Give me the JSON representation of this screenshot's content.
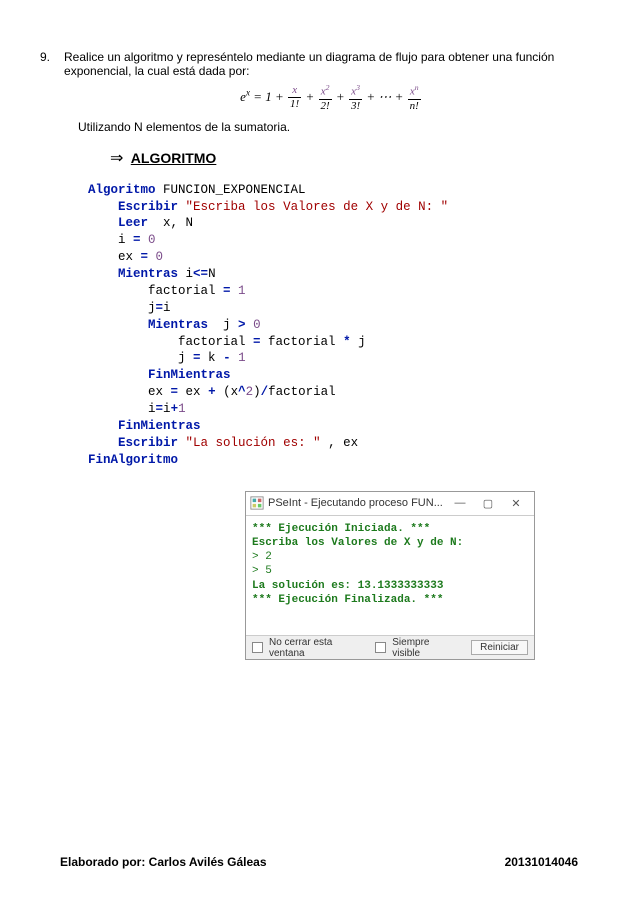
{
  "problem": {
    "number": "9.",
    "text": "Realice un algoritmo y represéntelo mediante un diagrama de flujo para obtener una función exponencial, la cual está dada por:",
    "formula_plain": "e^x = 1 + x/1! + x^2/2! + x^3/3! + ⋯ + x^n/n!",
    "tail": "Utilizando N elementos de la sumatoria."
  },
  "heading": "ALGORITMO",
  "code": {
    "l1_kw": "Algoritmo",
    "l1_id": " FUNCION_EXPONENCIAL",
    "l2_kw": "Escribir",
    "l2_str": "\"Escriba los Valores de X y de N: \"",
    "l3_kw": "Leer",
    "l3_id": "  x, N",
    "l4a": "i ",
    "l4op": "=",
    "l4num": " 0",
    "l5a": "ex ",
    "l5op": "=",
    "l5num": " 0",
    "l6_kw": "Mientras",
    "l6a": " i",
    "l6op": "<=",
    "l6b": "N",
    "l7a": "factorial ",
    "l7op": "=",
    "l7num": " 1",
    "l8a": "j",
    "l8op": "=",
    "l8b": "i",
    "l9_kw": "Mientras",
    "l9a": "  j ",
    "l9op": ">",
    "l9num": " 0",
    "l10a": "factorial ",
    "l10op": "=",
    "l10b": " factorial ",
    "l10op2": "*",
    "l10c": " j",
    "l11a": "j ",
    "l11op": "=",
    "l11b": " k ",
    "l11op2": "-",
    "l11num": " 1",
    "l12_kw": "FinMientras",
    "l13a": "ex ",
    "l13op": "=",
    "l13b": " ex ",
    "l13op2": "+",
    "l13c": " (",
    "l13d": "x",
    "l13op3": "^",
    "l13num": "2",
    "l13e": ")",
    "l13op4": "/",
    "l13f": "factorial",
    "l14a": "i",
    "l14op": "=",
    "l14b": "i",
    "l14op2": "+",
    "l14num": "1",
    "l15_kw": "FinMientras",
    "l16_kw": "Escribir",
    "l16_str": "\"La solución es: \"",
    "l16b": " , ex",
    "l17_kw": "FinAlgoritmo"
  },
  "console": {
    "title": "PSeInt - Ejecutando proceso FUN...",
    "lines": [
      "*** Ejecución Iniciada. ***",
      "Escriba los Valores de X y de N:",
      "> 2",
      "> 5",
      "La solución es: 13.1333333333",
      "*** Ejecución Finalizada. ***"
    ],
    "opt1": "No cerrar esta ventana",
    "opt2": "Siempre visible",
    "reinit": "Reiniciar"
  },
  "footer": {
    "left": "Elaborado por: Carlos Avilés Gáleas",
    "right": "20131014046"
  }
}
